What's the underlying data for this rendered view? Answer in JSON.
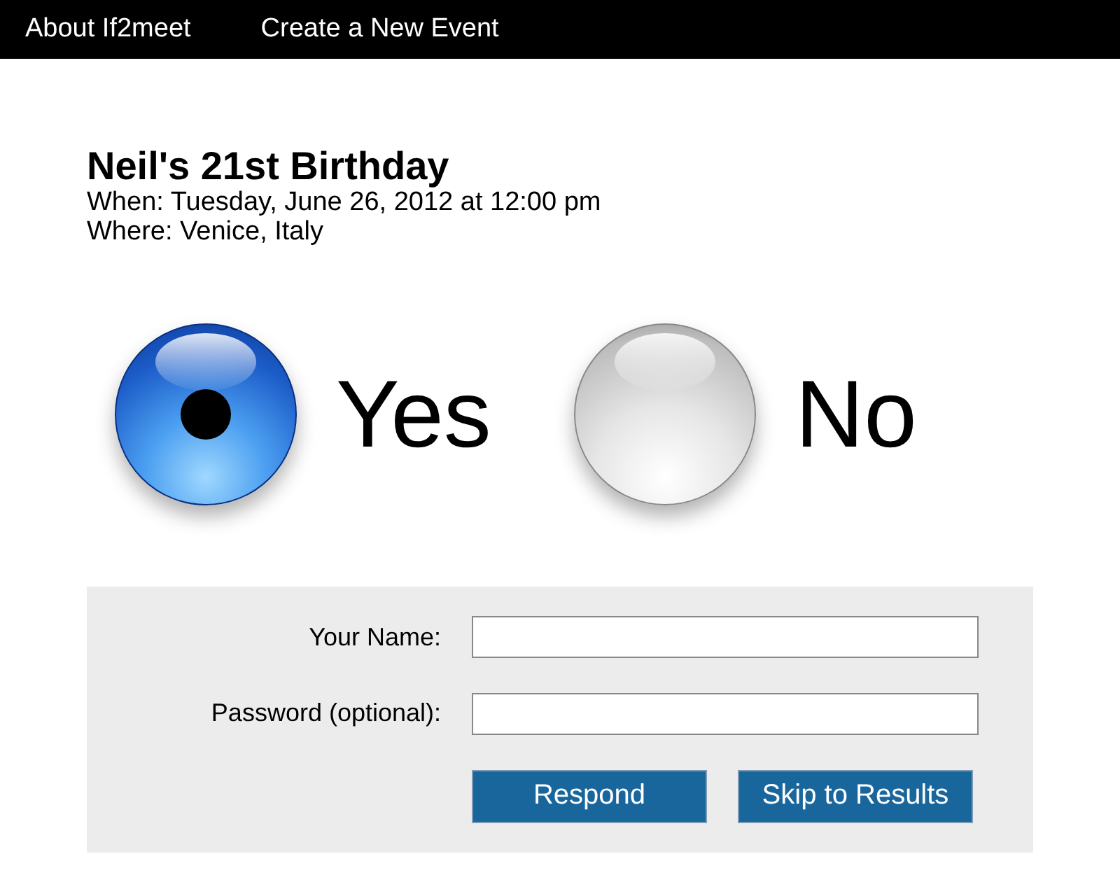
{
  "nav": [
    {
      "label": "About If2meet"
    },
    {
      "label": "Create a New Event"
    }
  ],
  "event": {
    "title": "Neil's 21st Birthday",
    "when": "When: Tuesday, June 26, 2012 at 12:00 pm",
    "where": "Where: Venice, Italy"
  },
  "choices": [
    {
      "label": "Yes",
      "selected": true
    },
    {
      "label": "No",
      "selected": false
    }
  ],
  "form": {
    "fields": [
      {
        "label": "Your Name:"
      },
      {
        "label": "Password (optional):"
      }
    ],
    "buttons": [
      {
        "label": "Respond"
      },
      {
        "label": "Skip to Results"
      }
    ]
  }
}
